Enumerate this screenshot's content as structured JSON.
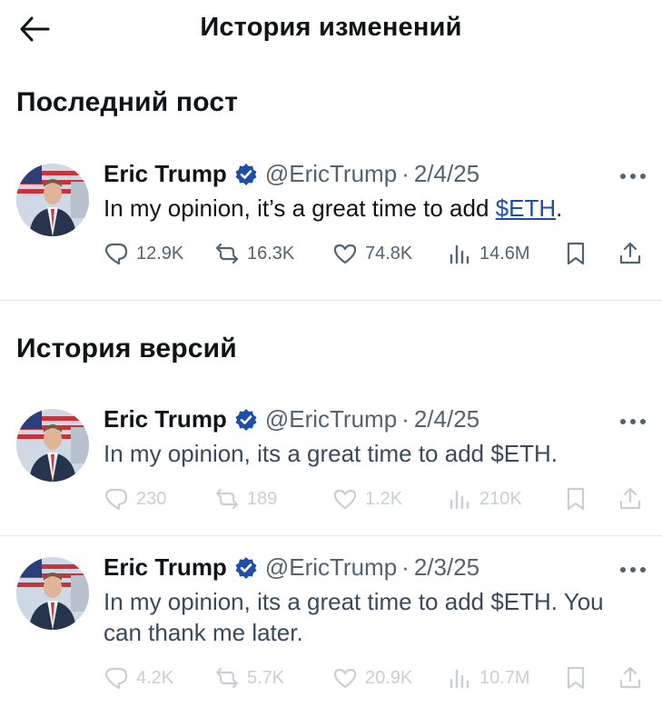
{
  "header": {
    "title": "История изменений"
  },
  "sections": {
    "latest": {
      "title": "Последний пост"
    },
    "history": {
      "title": "История версий"
    }
  },
  "tweets": [
    {
      "author": "Eric Trump",
      "handle": "@EricTrump",
      "dot": "·",
      "date": "2/4/25",
      "text_prefix": "In my opinion, it’s a great time to add ",
      "cashtag": "$ETH",
      "text_suffix": ".",
      "stats": {
        "replies": "12.9K",
        "reposts": "16.3K",
        "likes": "74.8K",
        "views": "14.6M"
      }
    },
    {
      "author": "Eric Trump",
      "handle": "@EricTrump",
      "dot": "·",
      "date": "2/4/25",
      "text": "In my opinion, its a great time to add $ETH.",
      "stats": {
        "replies": "230",
        "reposts": "189",
        "likes": "1.2K",
        "views": "210K"
      }
    },
    {
      "author": "Eric Trump",
      "handle": "@EricTrump",
      "dot": "·",
      "date": "2/3/25",
      "text": "In my opinion, its a great time to add $ETH. You can thank me later.",
      "stats": {
        "replies": "4.2K",
        "reposts": "5.7K",
        "likes": "20.9K",
        "views": "10.7M"
      }
    }
  ],
  "colors": {
    "text": "#0f1419",
    "muted": "#536471",
    "faded": "#c9cfd4",
    "link": "#1d4ea8",
    "verified": "#1d4ea8",
    "divider": "#e6e9eb"
  },
  "icons": [
    "back-arrow-icon",
    "verified-badge-icon",
    "more-icon",
    "reply-icon",
    "repost-icon",
    "like-icon",
    "views-icon",
    "bookmark-icon",
    "share-icon"
  ]
}
